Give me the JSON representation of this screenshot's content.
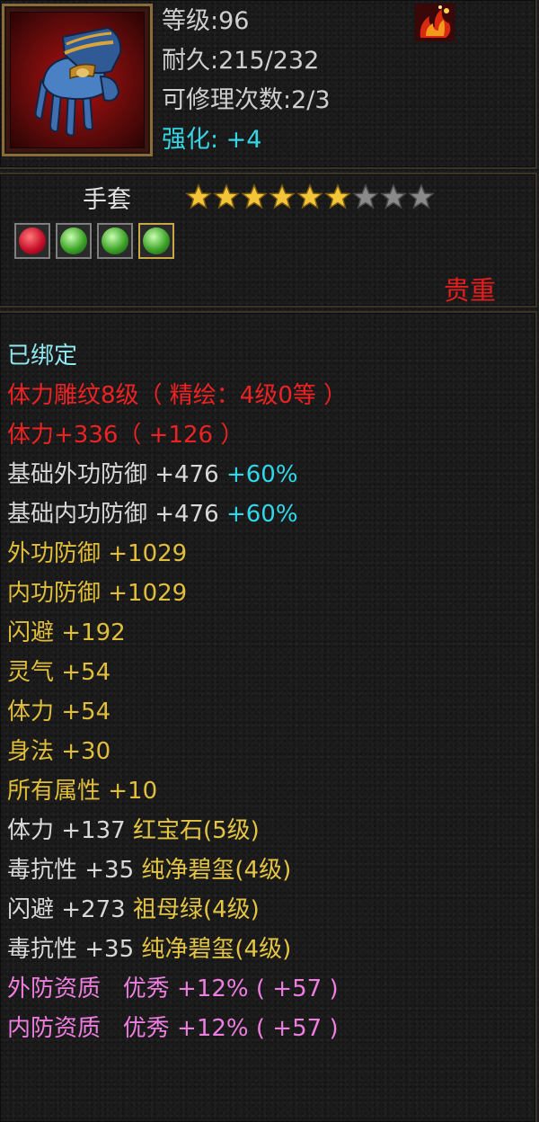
{
  "header": {
    "level_line": "等级:96",
    "durability_line": "耐久:215/232",
    "repair_line": "可修理次数:2/3",
    "enhance_line": "强化: +4",
    "item_icon": "gauntlet-icon",
    "corner_icon": "flame-emblem-icon"
  },
  "item": {
    "name": "手套",
    "stars_filled": 6,
    "stars_total": 9,
    "rarity": "贵重",
    "gems": [
      {
        "icon": "red-gem-icon",
        "color": "#c8102a"
      },
      {
        "icon": "green-gem-icon",
        "color": "#3fa52a"
      },
      {
        "icon": "green-gem-icon",
        "color": "#3fa52a"
      },
      {
        "icon": "green-gem-icon",
        "color": "#3fa52a"
      }
    ]
  },
  "stats": {
    "bound": "已绑定",
    "engrave": "体力雕纹8级（ 精绘：4级0等 ）",
    "stamina_main": "体力+336（ +126 ）",
    "base_ext_def": "基础外功防御 +476",
    "base_ext_def_pct": "+60%",
    "base_int_def": "基础内功防御 +476",
    "base_int_def_pct": "+60%",
    "ext_def": "外功防御 +1029",
    "int_def": "内功防御 +1029",
    "dodge": "闪避 +192",
    "spirit": "灵气 +54",
    "stamina": "体力 +54",
    "agility": "身法 +30",
    "all_attr": "所有属性 +10",
    "gem1_stat": "体力 +137",
    "gem1_name": "红宝石(5级)",
    "gem2_stat": "毒抗性 +35",
    "gem2_name": "纯净碧玺(4级)",
    "gem3_stat": "闪避 +273",
    "gem3_name": "祖母绿(4级)",
    "gem4_stat": "毒抗性 +35",
    "gem4_name": "纯净碧玺(4级)",
    "ext_quality": "外防资质   优秀 +12% ( +57 )",
    "int_quality": "内防资质   优秀 +12% ( +57 )"
  },
  "colors": {
    "gold": "#e0be3c",
    "cyan": "#34d6e6",
    "red": "#ee2222",
    "pink": "#ee7ee0",
    "rarity_red": "#e81d1d"
  }
}
